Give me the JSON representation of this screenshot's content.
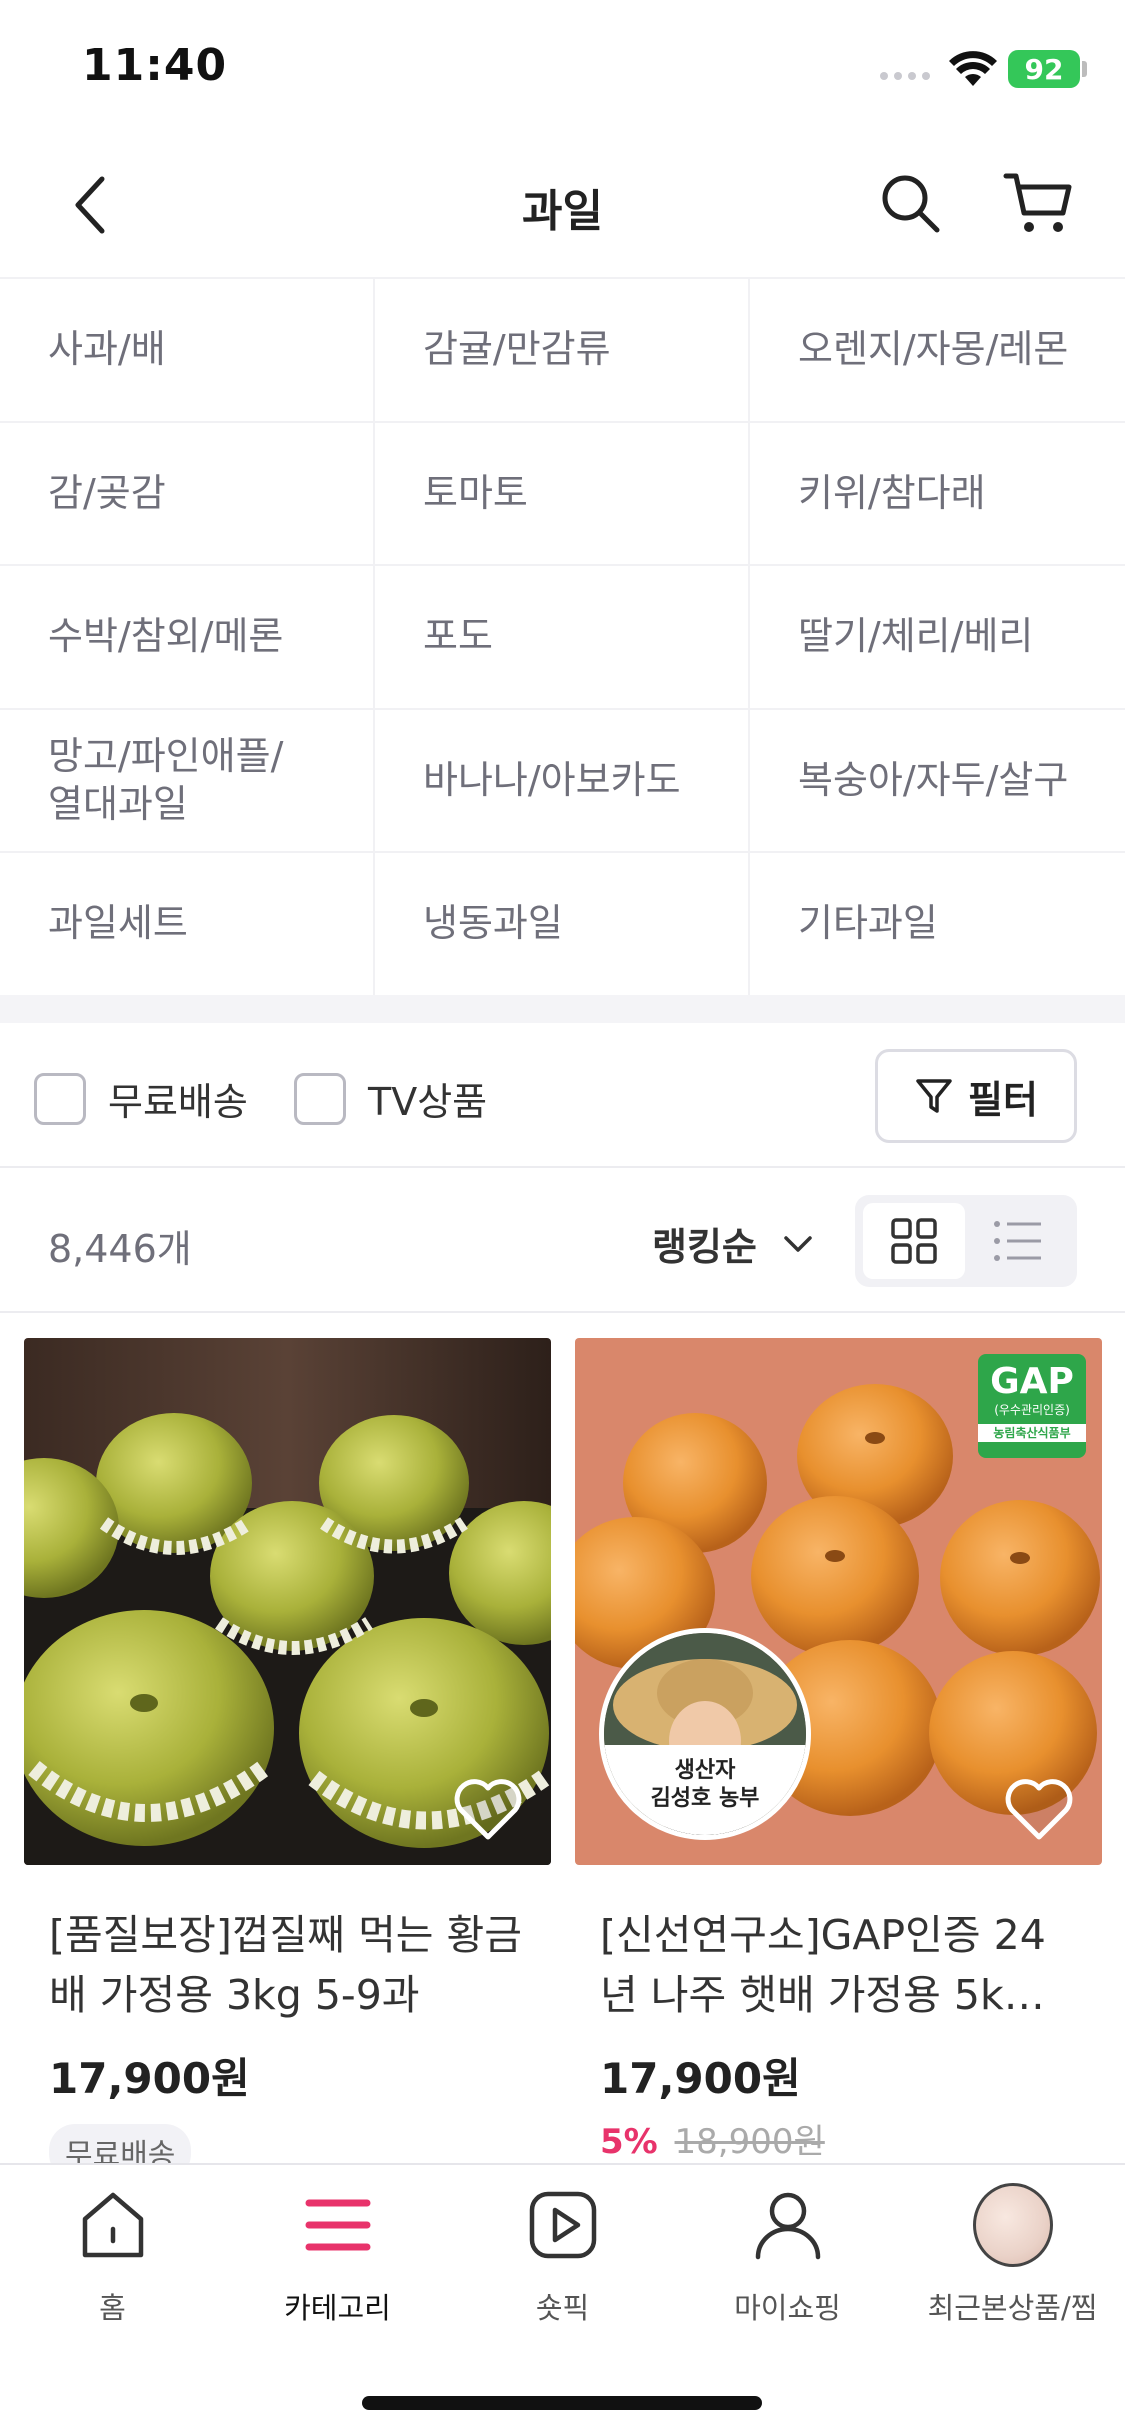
{
  "status_bar": {
    "time": "11:40",
    "battery": "92"
  },
  "header": {
    "title": "과일"
  },
  "categories": [
    "사과/배",
    "감귤/만감류",
    "오렌지/자몽/레몬",
    "감/곶감",
    "토마토",
    "키위/참다래",
    "수박/참외/메론",
    "포도",
    "딸기/체리/베리",
    "망고/파인애플/\n열대과일",
    "바나나/아보카도",
    "복숭아/자두/살구",
    "과일세트",
    "냉동과일",
    "기타과일"
  ],
  "filters": {
    "free_shipping": "무료배송",
    "tv_product": "TV상품",
    "filter_button": "필터"
  },
  "sort": {
    "count": "8,446개",
    "order": "랭킹순"
  },
  "products": [
    {
      "name": "[품질보장]껍질째 먹는 황금배 가정용 3kg 5-9과",
      "price": "17,900원",
      "badge": "무료배송"
    },
    {
      "name": "[신선연구소]GAP인증 24년 나주 햇배 가정용 5k…",
      "price": "17,900원",
      "discount_rate": "5%",
      "original_price": "18,900원",
      "producer": {
        "line1": "생산자",
        "line2": "김성호 농부"
      },
      "cert": {
        "title": "GAP",
        "sub": "(우수관리인증)",
        "ministry": "농림축산식품부"
      }
    }
  ],
  "tabs": [
    {
      "label": "홈"
    },
    {
      "label": "카테고리"
    },
    {
      "label": "숏픽"
    },
    {
      "label": "마이쇼핑"
    },
    {
      "label": "최근본상품/찜"
    }
  ],
  "colors": {
    "accent": "#e8336b",
    "battery": "#34c759",
    "gap_green": "#2ea64a"
  }
}
